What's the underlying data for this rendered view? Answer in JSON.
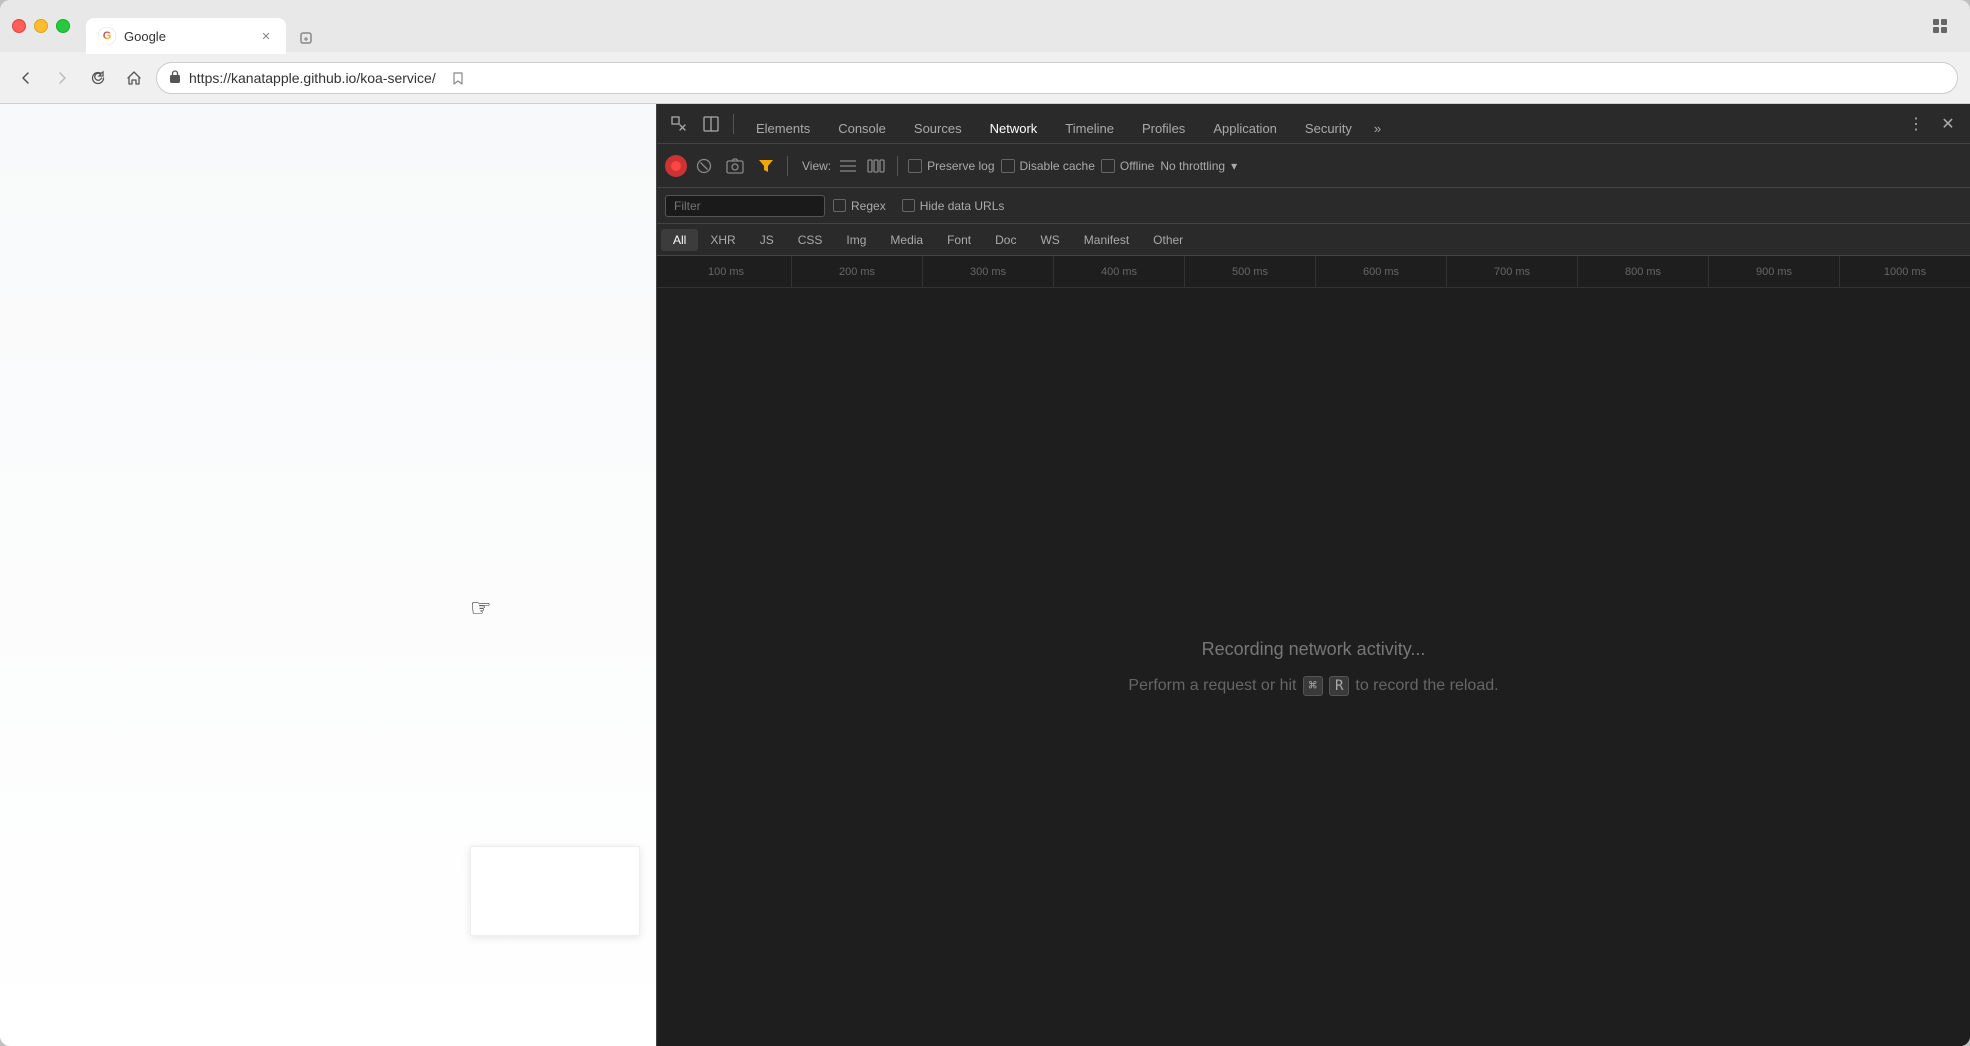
{
  "browser": {
    "tab": {
      "title": "Google",
      "url": "https://kanatapple.github.io/koa-service/",
      "favicon": "G"
    },
    "nav": {
      "back_disabled": false,
      "forward_disabled": true,
      "reload": "↻",
      "home": "⌂"
    }
  },
  "devtools": {
    "tabs": [
      {
        "label": "Elements",
        "active": false
      },
      {
        "label": "Console",
        "active": false
      },
      {
        "label": "Sources",
        "active": false
      },
      {
        "label": "Network",
        "active": true
      },
      {
        "label": "Timeline",
        "active": false
      },
      {
        "label": "Profiles",
        "active": false
      },
      {
        "label": "Application",
        "active": false
      },
      {
        "label": "Security",
        "active": false
      }
    ],
    "network": {
      "toolbar": {
        "view_label": "View:",
        "preserve_log_label": "Preserve log",
        "disable_cache_label": "Disable cache",
        "offline_label": "Offline",
        "no_throttling_label": "No throttling"
      },
      "filter": {
        "placeholder": "Filter",
        "regex_label": "Regex",
        "hide_data_urls_label": "Hide data URLs"
      },
      "resource_tabs": [
        {
          "label": "All",
          "active": true
        },
        {
          "label": "XHR",
          "active": false
        },
        {
          "label": "JS",
          "active": false
        },
        {
          "label": "CSS",
          "active": false
        },
        {
          "label": "Img",
          "active": false
        },
        {
          "label": "Media",
          "active": false
        },
        {
          "label": "Font",
          "active": false
        },
        {
          "label": "Doc",
          "active": false
        },
        {
          "label": "WS",
          "active": false
        },
        {
          "label": "Manifest",
          "active": false
        },
        {
          "label": "Other",
          "active": false
        }
      ],
      "timeline_ticks": [
        "100 ms",
        "200 ms",
        "300 ms",
        "400 ms",
        "500 ms",
        "600 ms",
        "700 ms",
        "800 ms",
        "900 ms",
        "1000 ms"
      ],
      "empty_state": {
        "line1": "Recording network activity...",
        "line2": "Perform a request or hit",
        "key1": "⌘",
        "key2": "R",
        "line2_suffix": "to record the reload."
      }
    }
  }
}
